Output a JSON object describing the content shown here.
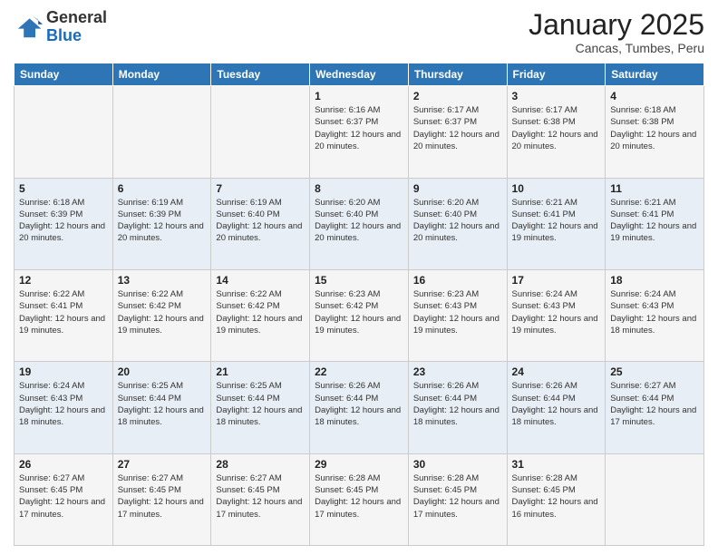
{
  "logo": {
    "general": "General",
    "blue": "Blue"
  },
  "header": {
    "title": "January 2025",
    "subtitle": "Cancas, Tumbes, Peru"
  },
  "weekdays": [
    "Sunday",
    "Monday",
    "Tuesday",
    "Wednesday",
    "Thursday",
    "Friday",
    "Saturday"
  ],
  "weeks": [
    [
      {
        "day": "",
        "sunrise": "",
        "sunset": "",
        "daylight": ""
      },
      {
        "day": "",
        "sunrise": "",
        "sunset": "",
        "daylight": ""
      },
      {
        "day": "",
        "sunrise": "",
        "sunset": "",
        "daylight": ""
      },
      {
        "day": "1",
        "sunrise": "Sunrise: 6:16 AM",
        "sunset": "Sunset: 6:37 PM",
        "daylight": "Daylight: 12 hours and 20 minutes."
      },
      {
        "day": "2",
        "sunrise": "Sunrise: 6:17 AM",
        "sunset": "Sunset: 6:37 PM",
        "daylight": "Daylight: 12 hours and 20 minutes."
      },
      {
        "day": "3",
        "sunrise": "Sunrise: 6:17 AM",
        "sunset": "Sunset: 6:38 PM",
        "daylight": "Daylight: 12 hours and 20 minutes."
      },
      {
        "day": "4",
        "sunrise": "Sunrise: 6:18 AM",
        "sunset": "Sunset: 6:38 PM",
        "daylight": "Daylight: 12 hours and 20 minutes."
      }
    ],
    [
      {
        "day": "5",
        "sunrise": "Sunrise: 6:18 AM",
        "sunset": "Sunset: 6:39 PM",
        "daylight": "Daylight: 12 hours and 20 minutes."
      },
      {
        "day": "6",
        "sunrise": "Sunrise: 6:19 AM",
        "sunset": "Sunset: 6:39 PM",
        "daylight": "Daylight: 12 hours and 20 minutes."
      },
      {
        "day": "7",
        "sunrise": "Sunrise: 6:19 AM",
        "sunset": "Sunset: 6:40 PM",
        "daylight": "Daylight: 12 hours and 20 minutes."
      },
      {
        "day": "8",
        "sunrise": "Sunrise: 6:20 AM",
        "sunset": "Sunset: 6:40 PM",
        "daylight": "Daylight: 12 hours and 20 minutes."
      },
      {
        "day": "9",
        "sunrise": "Sunrise: 6:20 AM",
        "sunset": "Sunset: 6:40 PM",
        "daylight": "Daylight: 12 hours and 20 minutes."
      },
      {
        "day": "10",
        "sunrise": "Sunrise: 6:21 AM",
        "sunset": "Sunset: 6:41 PM",
        "daylight": "Daylight: 12 hours and 19 minutes."
      },
      {
        "day": "11",
        "sunrise": "Sunrise: 6:21 AM",
        "sunset": "Sunset: 6:41 PM",
        "daylight": "Daylight: 12 hours and 19 minutes."
      }
    ],
    [
      {
        "day": "12",
        "sunrise": "Sunrise: 6:22 AM",
        "sunset": "Sunset: 6:41 PM",
        "daylight": "Daylight: 12 hours and 19 minutes."
      },
      {
        "day": "13",
        "sunrise": "Sunrise: 6:22 AM",
        "sunset": "Sunset: 6:42 PM",
        "daylight": "Daylight: 12 hours and 19 minutes."
      },
      {
        "day": "14",
        "sunrise": "Sunrise: 6:22 AM",
        "sunset": "Sunset: 6:42 PM",
        "daylight": "Daylight: 12 hours and 19 minutes."
      },
      {
        "day": "15",
        "sunrise": "Sunrise: 6:23 AM",
        "sunset": "Sunset: 6:42 PM",
        "daylight": "Daylight: 12 hours and 19 minutes."
      },
      {
        "day": "16",
        "sunrise": "Sunrise: 6:23 AM",
        "sunset": "Sunset: 6:43 PM",
        "daylight": "Daylight: 12 hours and 19 minutes."
      },
      {
        "day": "17",
        "sunrise": "Sunrise: 6:24 AM",
        "sunset": "Sunset: 6:43 PM",
        "daylight": "Daylight: 12 hours and 19 minutes."
      },
      {
        "day": "18",
        "sunrise": "Sunrise: 6:24 AM",
        "sunset": "Sunset: 6:43 PM",
        "daylight": "Daylight: 12 hours and 18 minutes."
      }
    ],
    [
      {
        "day": "19",
        "sunrise": "Sunrise: 6:24 AM",
        "sunset": "Sunset: 6:43 PM",
        "daylight": "Daylight: 12 hours and 18 minutes."
      },
      {
        "day": "20",
        "sunrise": "Sunrise: 6:25 AM",
        "sunset": "Sunset: 6:44 PM",
        "daylight": "Daylight: 12 hours and 18 minutes."
      },
      {
        "day": "21",
        "sunrise": "Sunrise: 6:25 AM",
        "sunset": "Sunset: 6:44 PM",
        "daylight": "Daylight: 12 hours and 18 minutes."
      },
      {
        "day": "22",
        "sunrise": "Sunrise: 6:26 AM",
        "sunset": "Sunset: 6:44 PM",
        "daylight": "Daylight: 12 hours and 18 minutes."
      },
      {
        "day": "23",
        "sunrise": "Sunrise: 6:26 AM",
        "sunset": "Sunset: 6:44 PM",
        "daylight": "Daylight: 12 hours and 18 minutes."
      },
      {
        "day": "24",
        "sunrise": "Sunrise: 6:26 AM",
        "sunset": "Sunset: 6:44 PM",
        "daylight": "Daylight: 12 hours and 18 minutes."
      },
      {
        "day": "25",
        "sunrise": "Sunrise: 6:27 AM",
        "sunset": "Sunset: 6:44 PM",
        "daylight": "Daylight: 12 hours and 17 minutes."
      }
    ],
    [
      {
        "day": "26",
        "sunrise": "Sunrise: 6:27 AM",
        "sunset": "Sunset: 6:45 PM",
        "daylight": "Daylight: 12 hours and 17 minutes."
      },
      {
        "day": "27",
        "sunrise": "Sunrise: 6:27 AM",
        "sunset": "Sunset: 6:45 PM",
        "daylight": "Daylight: 12 hours and 17 minutes."
      },
      {
        "day": "28",
        "sunrise": "Sunrise: 6:27 AM",
        "sunset": "Sunset: 6:45 PM",
        "daylight": "Daylight: 12 hours and 17 minutes."
      },
      {
        "day": "29",
        "sunrise": "Sunrise: 6:28 AM",
        "sunset": "Sunset: 6:45 PM",
        "daylight": "Daylight: 12 hours and 17 minutes."
      },
      {
        "day": "30",
        "sunrise": "Sunrise: 6:28 AM",
        "sunset": "Sunset: 6:45 PM",
        "daylight": "Daylight: 12 hours and 17 minutes."
      },
      {
        "day": "31",
        "sunrise": "Sunrise: 6:28 AM",
        "sunset": "Sunset: 6:45 PM",
        "daylight": "Daylight: 12 hours and 16 minutes."
      },
      {
        "day": "",
        "sunrise": "",
        "sunset": "",
        "daylight": ""
      }
    ]
  ]
}
